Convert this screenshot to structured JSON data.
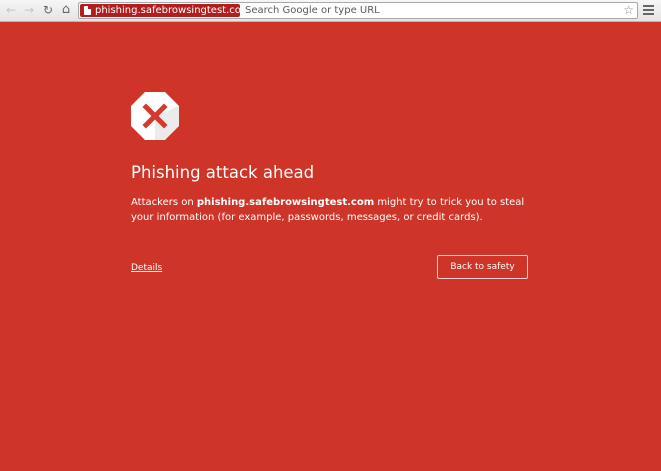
{
  "browser": {
    "back_icon": "back-arrow-icon",
    "back_glyph": "←",
    "forward_icon": "forward-arrow-icon",
    "forward_glyph": "→",
    "reload_icon": "reload-icon",
    "reload_glyph": "↻",
    "home_icon": "home-icon",
    "home_glyph": "⌂",
    "security_chip": {
      "icon": "page-icon",
      "domain": "phishing.safebrowsingtest.com"
    },
    "omnibox": {
      "value": "",
      "placeholder": "Search Google or type URL"
    },
    "bookmark_icon": "star-icon",
    "bookmark_glyph": "☆",
    "menu_icon": "hamburger-menu-icon"
  },
  "interstitial": {
    "icon": "red-x-octagon-icon",
    "heading": "Phishing attack ahead",
    "body_prefix": "Attackers on ",
    "body_domain": "phishing.safebrowsingtest.com",
    "body_suffix": " might try to trick you to steal your information (for example, passwords, messages, or credit cards).",
    "details_link": "Details",
    "back_button": "Back to safety"
  },
  "colors": {
    "page_background": "#ce3428",
    "chip_background": "#b21e1e",
    "icon_x_color": "#d23a2d"
  }
}
